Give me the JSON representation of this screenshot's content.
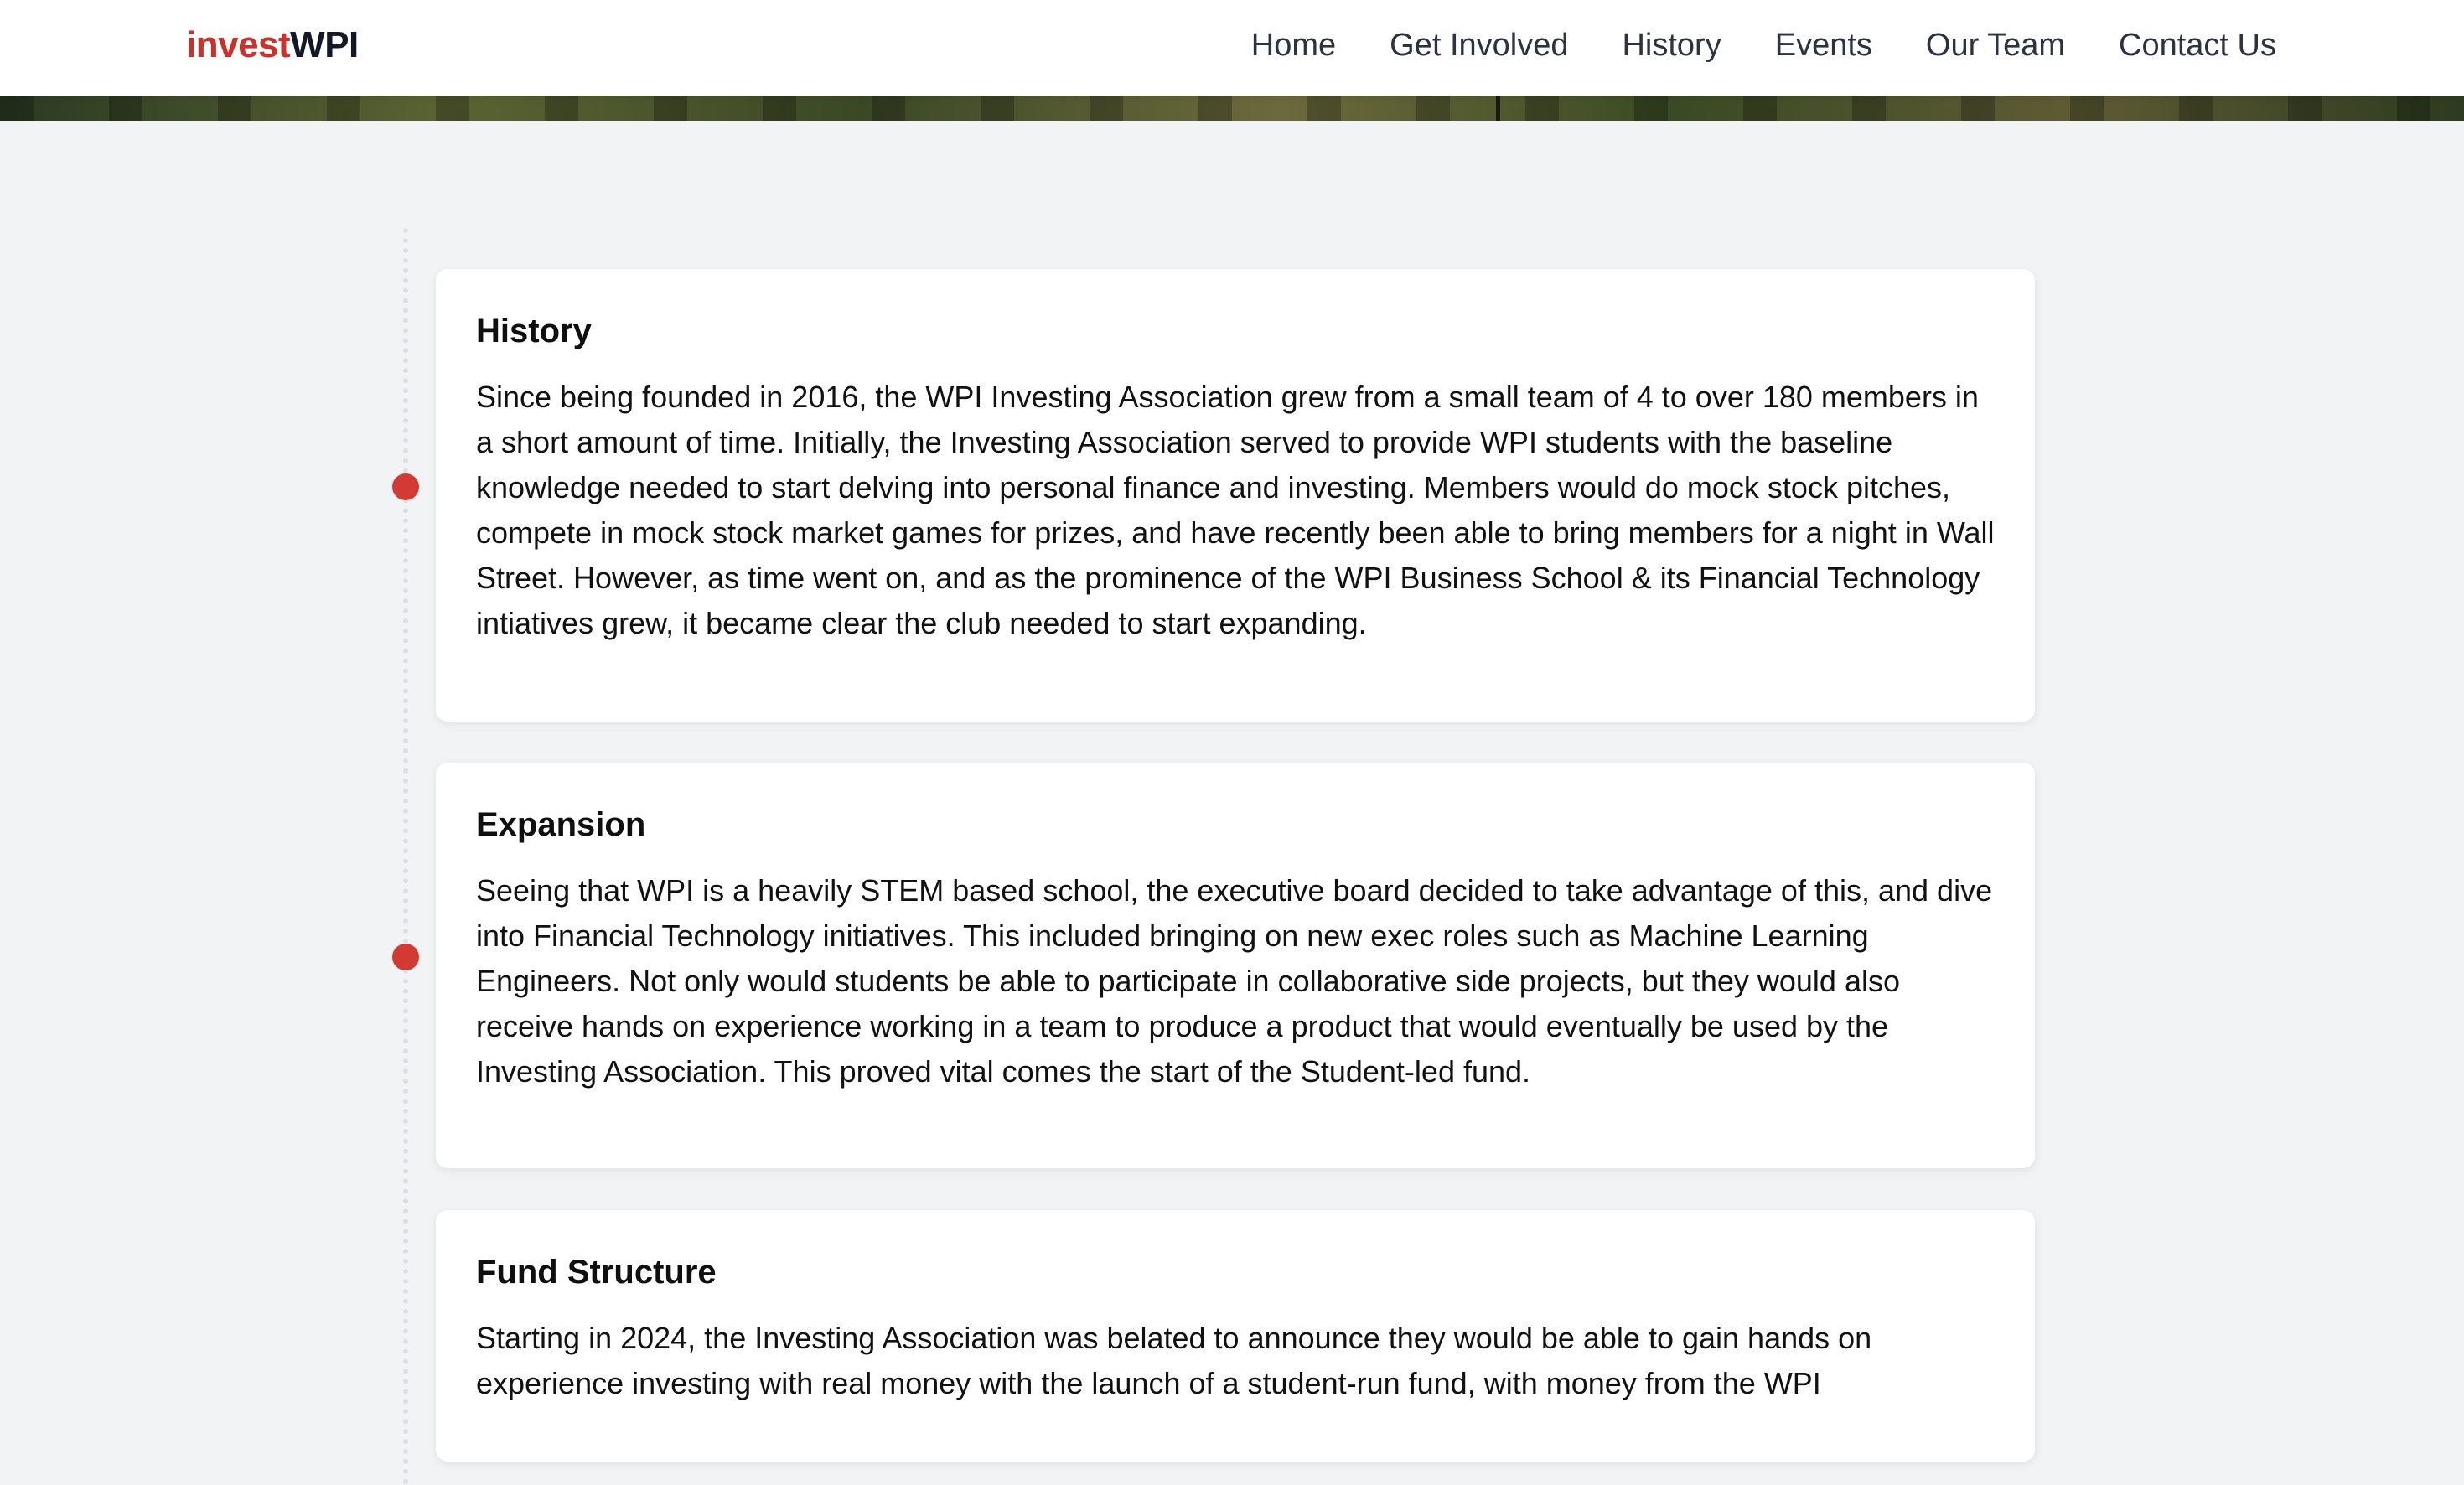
{
  "header": {
    "logo_invest": "invest",
    "logo_wpi": "WPI",
    "nav": [
      "Home",
      "Get Involved",
      "History",
      "Events",
      "Our Team",
      "Contact Us"
    ]
  },
  "colors": {
    "accent": "#d23b33",
    "logo_red": "#c9322b",
    "logo_dark": "#121826",
    "background": "#f2f3f5"
  },
  "timeline": [
    {
      "title": "History",
      "body": "Since being founded in 2016, the WPI Investing Association grew from a small team of 4 to over 180 members in a short amount of time. Initially, the Investing Association served to provide WPI students with the baseline knowledge needed to start delving into personal finance and investing. Members would do mock stock pitches, compete in mock stock market games for prizes, and have recently been able to bring members for a night in Wall Street. However, as time went on, and as the prominence of the WPI Business School & its Financial Technology intiatives grew, it became clear the club needed to start expanding."
    },
    {
      "title": "Expansion",
      "body": "Seeing that WPI is a heavily STEM based school, the executive board decided to take advantage of this, and dive into Financial Technology initiatives. This included bringing on new exec roles such as Machine Learning Engineers. Not only would students be able to participate in collaborative side projects, but they would also receive hands on experience working in a team to produce a product that would eventually be used by the Investing Association. This proved vital comes the start of the Student-led fund."
    },
    {
      "title": "Fund Structure",
      "body": "Starting in 2024, the Investing Association was belated to announce they would be able to gain hands on experience investing with real money with the launch of a student-run fund, with money from the WPI"
    }
  ]
}
